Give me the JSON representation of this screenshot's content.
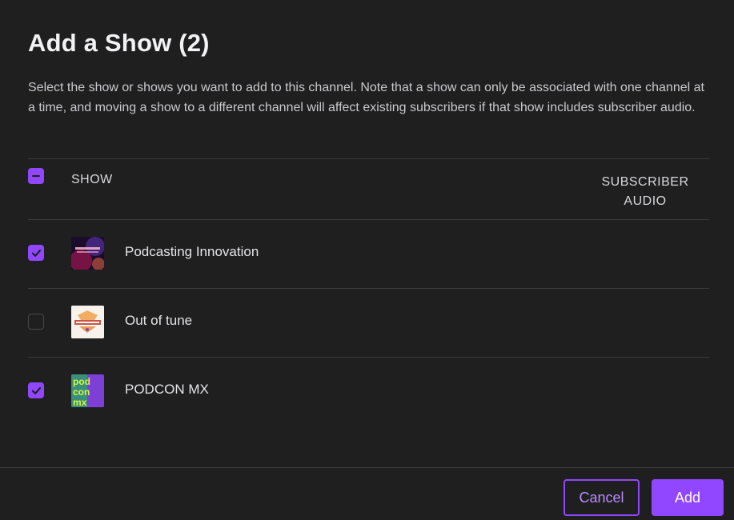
{
  "dialog": {
    "title": "Add a Show (2)",
    "description": "Select the show or shows you want to add to this channel. Note that a show can only be associated with one channel at a time, and moving a show to a different channel will affect existing subscribers if that show includes subscriber audio."
  },
  "table": {
    "select_all_state": "indeterminate",
    "columns": {
      "show": "SHOW",
      "subscriber_audio_line1": "SUBSCRIBER",
      "subscriber_audio_line2": "AUDIO"
    },
    "rows": [
      {
        "name": "Podcasting Innovation",
        "checked": true,
        "thumbnail": "podcasting-innovation-artwork",
        "thumb_text": "PODCASTING INNOVATION"
      },
      {
        "name": "Out of tune",
        "checked": false,
        "thumbnail": "out-of-tune-artwork",
        "thumb_text": "OUT OF TUNE"
      },
      {
        "name": "PODCON MX",
        "checked": true,
        "thumbnail": "podcon-mx-artwork",
        "thumb_text": [
          "pod",
          "con",
          "mx"
        ]
      }
    ]
  },
  "footer": {
    "cancel_label": "Cancel",
    "add_label": "Add"
  },
  "colors": {
    "background": "#1f1f20",
    "accent": "#9147ff",
    "accent_text": "#b98cff",
    "divider": "#3a3a3d",
    "text_primary": "#f2f2f4",
    "text_secondary": "#c9c9cd"
  }
}
